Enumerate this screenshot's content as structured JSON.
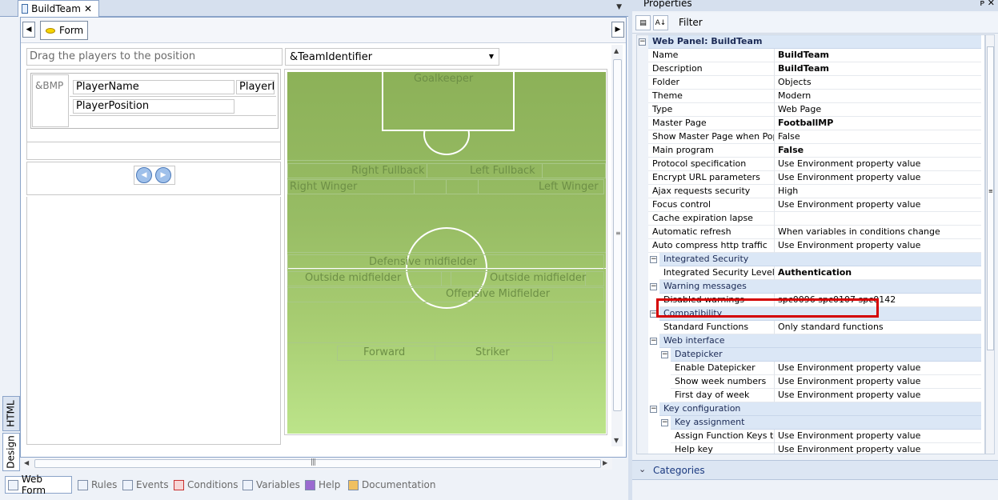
{
  "document_tab": {
    "title": "BuildTeam",
    "close": "✕"
  },
  "designer": {
    "nav_left": "◀",
    "nav_right": "▶",
    "form_button": "Form",
    "drag_hint": "Drag the players to the position",
    "team_select": "&TeamIdentifier",
    "bmp_label": "&BMP",
    "player_name_field": "PlayerName",
    "player_id_field": "PlayerI",
    "player_position_field": "PlayerPosition",
    "pager_prev": "◀",
    "pager_next": "▶",
    "positions": {
      "goalkeeper": "Goalkeeper",
      "right_fullback": "Right Fullback",
      "left_fullback": "Left Fullback",
      "right_winger": "Right Winger",
      "left_winger": "Left Winger",
      "defensive_midfielder": "Defensive midfielder",
      "outside_midfielder_left": "Outside midfielder",
      "outside_midfielder_right": "Outside midfielder",
      "offensive_midfielder": "Offensive Midfielder",
      "forward": "Forward",
      "striker": "Striker"
    }
  },
  "side_tabs": {
    "html": "HTML",
    "design": "Design"
  },
  "bottom_tabs": [
    {
      "label": "Web Form",
      "active": true
    },
    {
      "label": "Rules",
      "active": false
    },
    {
      "label": "Events",
      "active": false
    },
    {
      "label": "Conditions",
      "active": false
    },
    {
      "label": "Variables",
      "active": false
    },
    {
      "label": "Help",
      "active": false
    },
    {
      "label": "Documentation",
      "active": false
    }
  ],
  "properties": {
    "title": "Properties",
    "header_buttons": "ᴘ ✕",
    "filter_label": "Filter",
    "root": "Web Panel: BuildTeam",
    "rows": [
      {
        "name": "Name",
        "value": "BuildTeam",
        "bold": true
      },
      {
        "name": "Description",
        "value": "BuildTeam",
        "bold": true
      },
      {
        "name": "Folder",
        "value": "Objects",
        "bold": false
      },
      {
        "name": "Theme",
        "value": "Modern",
        "bold": false
      },
      {
        "name": "Type",
        "value": "Web Page",
        "bold": false
      },
      {
        "name": "Master Page",
        "value": "FootballMP",
        "bold": true
      },
      {
        "name": "Show Master Page when Pop-up",
        "value": "False",
        "bold": false
      },
      {
        "name": "Main program",
        "value": "False",
        "bold": true
      },
      {
        "name": "Protocol specification",
        "value": "Use Environment property value",
        "bold": false
      },
      {
        "name": "Encrypt URL parameters",
        "value": "Use Environment property value",
        "bold": false
      },
      {
        "name": "Ajax requests security",
        "value": "High",
        "bold": false
      },
      {
        "name": "Focus control",
        "value": "Use Environment property value",
        "bold": false
      },
      {
        "name": "Cache expiration lapse",
        "value": "",
        "bold": false
      },
      {
        "name": "Automatic refresh",
        "value": "When variables in conditions change",
        "bold": false
      },
      {
        "name": "Auto compress http traffic",
        "value": "Use Environment property value",
        "bold": false
      }
    ],
    "integrated_security": {
      "category": "Integrated Security",
      "level_name": "Integrated Security Level",
      "level_value": "Authentication"
    },
    "warning_messages": {
      "category": "Warning messages",
      "name": "Disabled warnings",
      "value": "spc0096 spc0107 spc0142"
    },
    "compatibility": {
      "category": "Compatibility",
      "name": "Standard Functions",
      "value": "Only standard functions"
    },
    "web_interface": {
      "category": "Web interface",
      "datepicker": "Datepicker",
      "rows": [
        {
          "name": "Enable Datepicker",
          "value": "Use Environment property value"
        },
        {
          "name": "Show week numbers",
          "value": "Use Environment property value"
        },
        {
          "name": "First day of week",
          "value": "Use Environment property value"
        }
      ]
    },
    "key_configuration": {
      "category": "Key configuration",
      "assignment": "Key assignment",
      "rows": [
        {
          "name": "Assign Function Keys to Screen",
          "value": "Use Environment property value"
        },
        {
          "name": "Help key",
          "value": "Use Environment property value"
        }
      ]
    },
    "categories_label": "Categories"
  },
  "colors": {
    "highlight_border": "#d40000",
    "category_band": "#dbe7f6",
    "pitch_top": "#8cb158",
    "pitch_bottom": "#bce48a"
  }
}
